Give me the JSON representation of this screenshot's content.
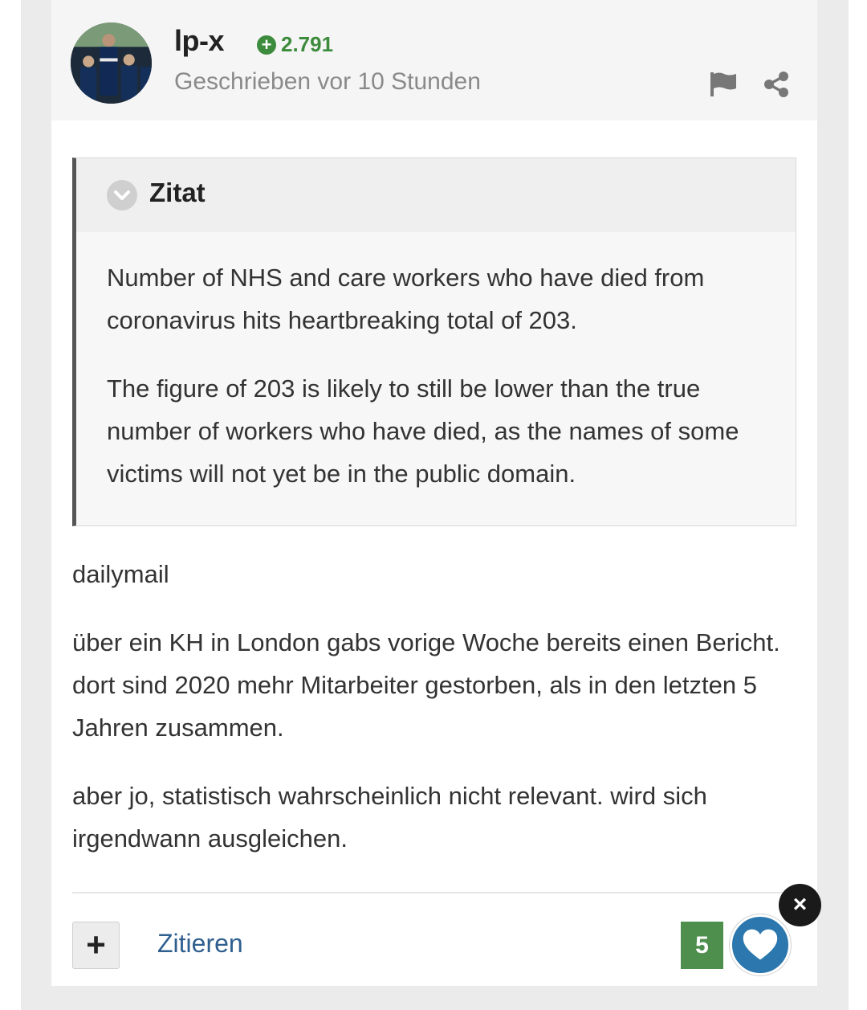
{
  "post": {
    "author": "lp-x",
    "reputation": "2.791",
    "meta": "Geschrieben vor 10 Stunden"
  },
  "quote": {
    "title": "Zitat",
    "paragraphs": [
      "Number of NHS and care workers who have died from coronavirus hits heartbreaking total of 203.",
      "The figure of 203 is likely to still be lower than the true number of workers who have died, as the names of some victims will not yet be in the public domain."
    ]
  },
  "body": {
    "paragraphs": [
      "dailymail",
      "über ein KH in London gabs vorige Woche bereits einen Bericht. dort sind 2020 mehr Mitarbeiter gestorben, als in den letzten 5 Jahren zusammen.",
      "aber jo, statistisch wahrscheinlich nicht relevant. wird sich irgendwann ausgleichen."
    ]
  },
  "footer": {
    "plus_label": "+",
    "quote_label": "Zitieren",
    "like_count": "5",
    "close_label": "×"
  },
  "icons": {
    "reputation": "plus-circle-icon",
    "report": "flag-icon",
    "share": "share-icon",
    "quote_toggle": "chevron-down-icon",
    "like": "heart-icon",
    "close": "close-icon"
  },
  "colors": {
    "reputation_green": "#3d8b3d",
    "link_blue": "#2f5f8f",
    "like_blue": "#2b77ae",
    "count_green": "#4e8f4e"
  }
}
